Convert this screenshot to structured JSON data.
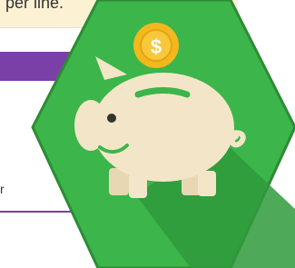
{
  "banner": {
    "text": "per line."
  },
  "fragment": {
    "line1": "",
    "line2": "r"
  },
  "badge": {
    "icon": "piggy-bank-icon",
    "coin_symbol": "$",
    "colors": {
      "hex_fill": "#3cb54a",
      "hex_shadow": "#2f9a3b",
      "hex_border": "#2e8b35",
      "pig": "#f3e6c8",
      "coin": "#f2b81c",
      "coin_inner": "#f7c83b"
    }
  }
}
